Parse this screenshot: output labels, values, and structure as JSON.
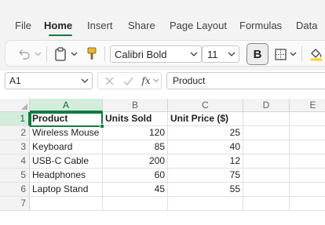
{
  "ribbon": {
    "tabs": [
      {
        "label": "File"
      },
      {
        "label": "Home",
        "active": true
      },
      {
        "label": "Insert"
      },
      {
        "label": "Share"
      },
      {
        "label": "Page Layout"
      },
      {
        "label": "Formulas"
      },
      {
        "label": "Data"
      }
    ]
  },
  "toolbar": {
    "undo_icon": "undo-icon",
    "paste_icon": "clipboard-icon",
    "format_painter_icon": "paintbrush-icon",
    "font_name": "Calibri Bold",
    "font_size": "11",
    "bold_label": "B",
    "border_icon": "borders-icon",
    "fill_color_icon": "fill-color-icon",
    "accent_color": "#107c41"
  },
  "formula_bar": {
    "name_box": "A1",
    "formula_value": "Product",
    "fx_label": "fx"
  },
  "sheet": {
    "columns": [
      "A",
      "B",
      "C",
      "D",
      "E"
    ],
    "selected_column": "A",
    "selected_row": "1",
    "rows": [
      {
        "num": "1",
        "cells": [
          "Product",
          "Units Sold",
          "Unit Price ($)",
          "",
          ""
        ]
      },
      {
        "num": "2",
        "cells": [
          "Wireless Mouse",
          "120",
          "25",
          "",
          ""
        ]
      },
      {
        "num": "3",
        "cells": [
          "Keyboard",
          "85",
          "40",
          "",
          ""
        ]
      },
      {
        "num": "4",
        "cells": [
          "USB-C Cable",
          "200",
          "12",
          "",
          ""
        ]
      },
      {
        "num": "5",
        "cells": [
          "Headphones",
          "60",
          "75",
          "",
          ""
        ]
      },
      {
        "num": "6",
        "cells": [
          "Laptop Stand",
          "45",
          "55",
          "",
          ""
        ]
      },
      {
        "num": "7",
        "cells": [
          "",
          "",
          "",
          "",
          ""
        ]
      }
    ]
  }
}
